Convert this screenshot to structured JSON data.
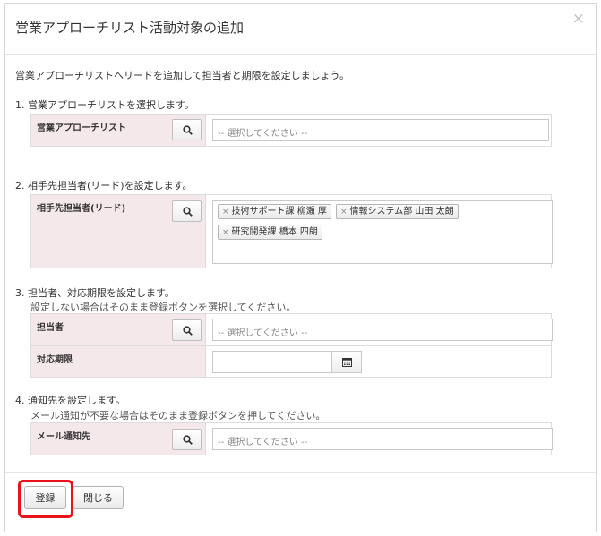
{
  "modal": {
    "title": "営業アプローチリスト活動対象の追加",
    "close": "×",
    "intro": "営業アプローチリストへリードを追加して担当者と期限を設定しましょう。"
  },
  "step1": {
    "heading": "1. 営業アプローチリストを選択します。",
    "label": "営業アプローチリスト",
    "placeholder": "-- 選択してください --"
  },
  "step2": {
    "heading": "2. 相手先担当者(リード)を設定します。",
    "label": "相手先担当者(リード)",
    "tag_remove": "×",
    "tags": [
      "技術サポート課 柳瀬 厚",
      "情報システム部 山田 太朗",
      "研究開発課 橋本 四朗"
    ]
  },
  "step3": {
    "heading": "3. 担当者、対応期限を設定します。",
    "sub": "設定しない場合はそのまま登録ボタンを選択してください。",
    "assignee_label": "担当者",
    "assignee_placeholder": "-- 選択してください --",
    "deadline_label": "対応期限",
    "deadline_value": ""
  },
  "step4": {
    "heading": "4. 通知先を設定します。",
    "sub": "メール通知が不要な場合はそのまま登録ボタンを押してください。",
    "label": "メール通知先",
    "placeholder": "-- 選択してください --"
  },
  "footer": {
    "register": "登録",
    "close": "閉じる"
  },
  "colors": {
    "label_bg": "#f5e8ea",
    "highlight": "#e8121b"
  }
}
